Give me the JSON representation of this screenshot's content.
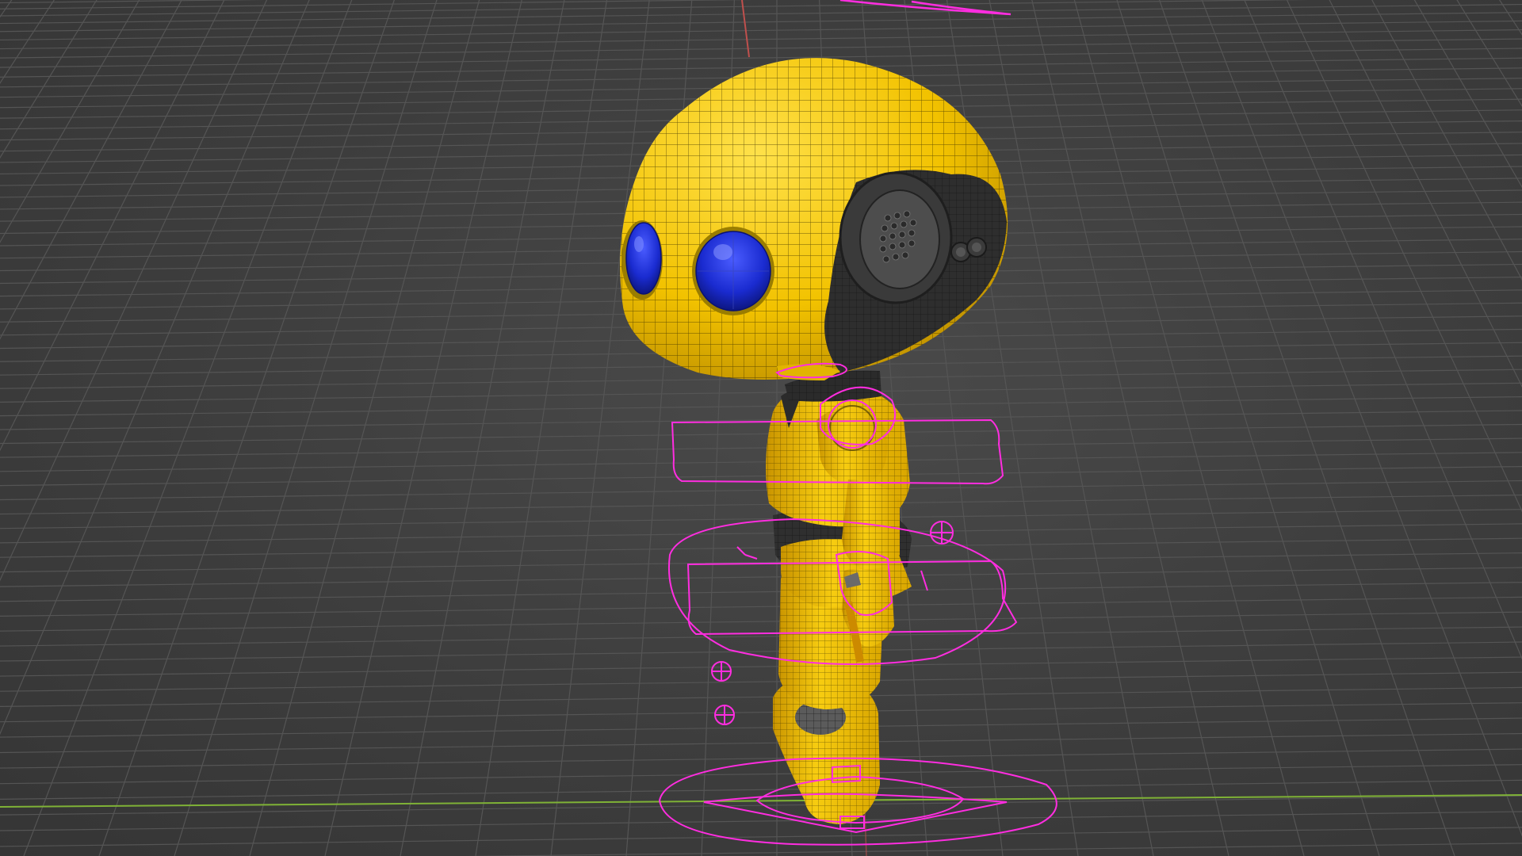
{
  "viewport": {
    "background_color": "#3c3c3c",
    "grid_line_color": "#555555",
    "x_axis_color": "#7fb236",
    "y_axis_color": "#c0504d"
  },
  "character": {
    "body_color": "#f2c200",
    "shadow_color": "#b88a00",
    "wireframe_color": "#3a2f00",
    "eye_color": "#1a2bd0",
    "dark_part_color": "#2b2b2b"
  },
  "rig": {
    "control_color": "#ff2de0"
  }
}
